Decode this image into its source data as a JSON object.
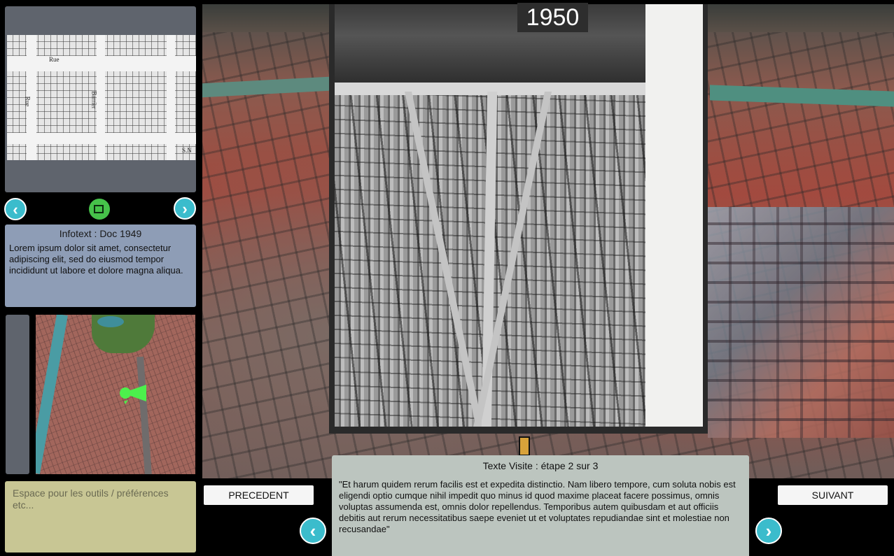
{
  "viewer": {
    "year": "1950"
  },
  "doc_panel": {
    "map_labels": [
      "Rue",
      "Rue",
      "Barrier",
      "S.N"
    ],
    "prev_icon": "chevron-left-icon",
    "next_icon": "chevron-right-icon",
    "media_icon": "video-camera-icon",
    "prev_glyph": "‹",
    "next_glyph": "›"
  },
  "info": {
    "title": "Infotext : Doc 1949",
    "body": "Lorem ipsum dolor sit amet, consectetur adipiscing elit, sed do eiusmod tempor incididunt ut labore et dolore magna aliqua."
  },
  "tools": {
    "placeholder": "Espace pour les outils / préférences etc..."
  },
  "navigation": {
    "prev_label": "PRECEDENT",
    "next_label": "SUIVANT"
  },
  "visit": {
    "title": "Texte Visite : étape 2 sur 3",
    "body": "\"Et harum quidem rerum facilis est et expedita distinctio. Nam libero tempore, cum soluta nobis est eligendi optio cumque nihil impedit quo minus id quod maxime placeat facere possimus, omnis voluptas assumenda est, omnis dolor repellendus. Temporibus autem quibusdam et aut officiis debitis aut rerum necessitatibus saepe eveniet ut et voluptates repudiandae sint et molestiae non recusandae\"",
    "step_current": 2,
    "step_total": 3,
    "prev_glyph": "‹",
    "next_glyph": "›"
  },
  "colors": {
    "accent_button": "#3bbccc",
    "media_button": "#46c24a",
    "location_marker": "#4cf04c",
    "info_panel": "#8e9db6",
    "tools_panel": "#c8c694",
    "visit_panel": "#bcc5bf"
  }
}
